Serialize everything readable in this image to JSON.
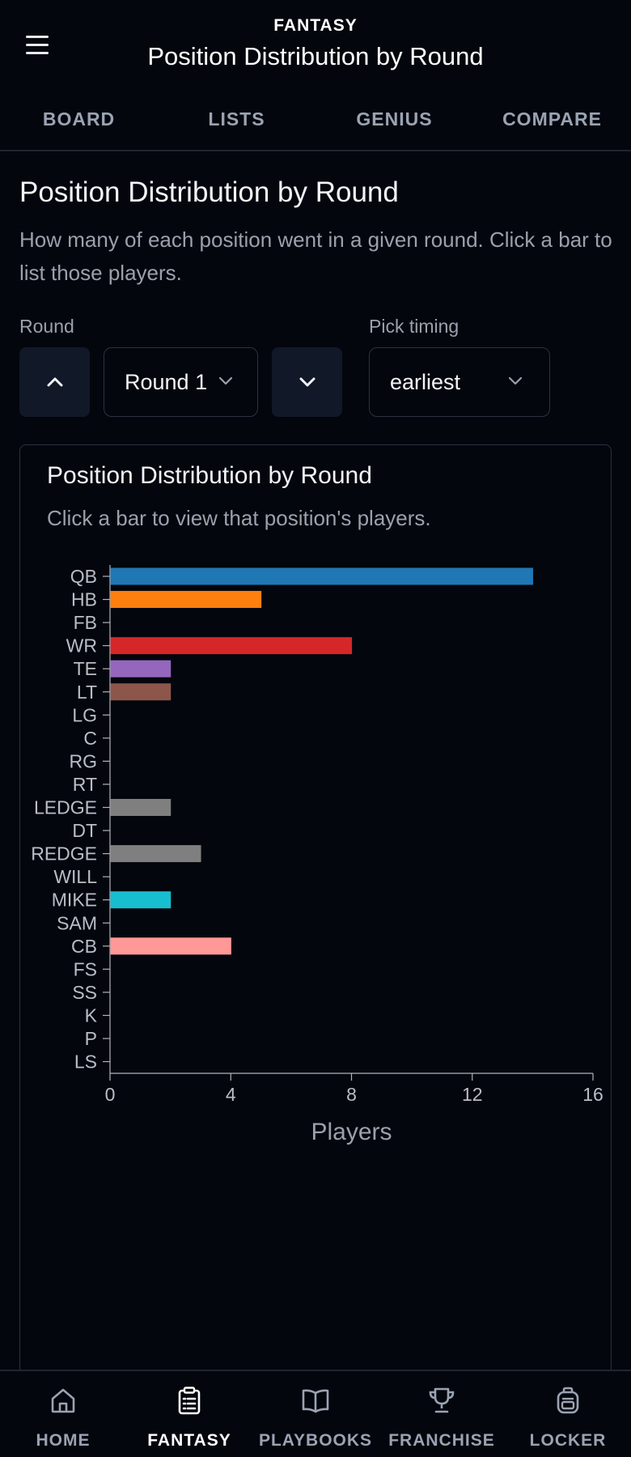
{
  "header": {
    "section": "FANTASY",
    "title": "Position Distribution by Round"
  },
  "tabs": [
    "BOARD",
    "LISTS",
    "GENIUS",
    "COMPARE"
  ],
  "page": {
    "title": "Position Distribution by Round",
    "description": "How many of each position went in a given round. Click a bar to list those players."
  },
  "controls": {
    "round_label": "Round",
    "round_value": "Round 1",
    "timing_label": "Pick timing",
    "timing_value": "earliest"
  },
  "card": {
    "title": "Position Distribution by Round",
    "subtitle": "Click a bar to view that position's players."
  },
  "chart_data": {
    "type": "bar",
    "orientation": "horizontal",
    "categories": [
      "QB",
      "HB",
      "FB",
      "WR",
      "TE",
      "LT",
      "LG",
      "C",
      "RG",
      "RT",
      "LEDGE",
      "DT",
      "REDGE",
      "WILL",
      "MIKE",
      "SAM",
      "CB",
      "FS",
      "SS",
      "K",
      "P",
      "LS"
    ],
    "values": [
      14,
      5,
      0,
      8,
      2,
      2,
      0,
      0,
      0,
      0,
      2,
      0,
      3,
      0,
      2,
      0,
      4,
      0,
      0,
      0,
      0,
      0
    ],
    "colors": [
      "#1f77b4",
      "#ff7f0e",
      "#2ca02c",
      "#d62728",
      "#9467bd",
      "#8c564b",
      "#e377c2",
      "#7f7f7f",
      "#bcbd22",
      "#17becf",
      "#7f7f7f",
      "#bcbd22",
      "#7f7f7f",
      "#bcbd22",
      "#17becf",
      "#1f77b4",
      "#ff9896",
      "#aec7e8",
      "#ffbb78",
      "#98df8a",
      "#c5b0d5",
      "#c49c94"
    ],
    "xlabel": "Players",
    "ylabel": "",
    "xlim": [
      0,
      16
    ],
    "xticks": [
      0,
      4,
      8,
      12,
      16
    ],
    "grid": false
  },
  "nav": [
    {
      "label": "HOME",
      "icon": "home-icon"
    },
    {
      "label": "FANTASY",
      "icon": "clipboard-icon"
    },
    {
      "label": "PLAYBOOKS",
      "icon": "book-icon"
    },
    {
      "label": "FRANCHISE",
      "icon": "trophy-icon"
    },
    {
      "label": "LOCKER",
      "icon": "backpack-icon"
    }
  ]
}
